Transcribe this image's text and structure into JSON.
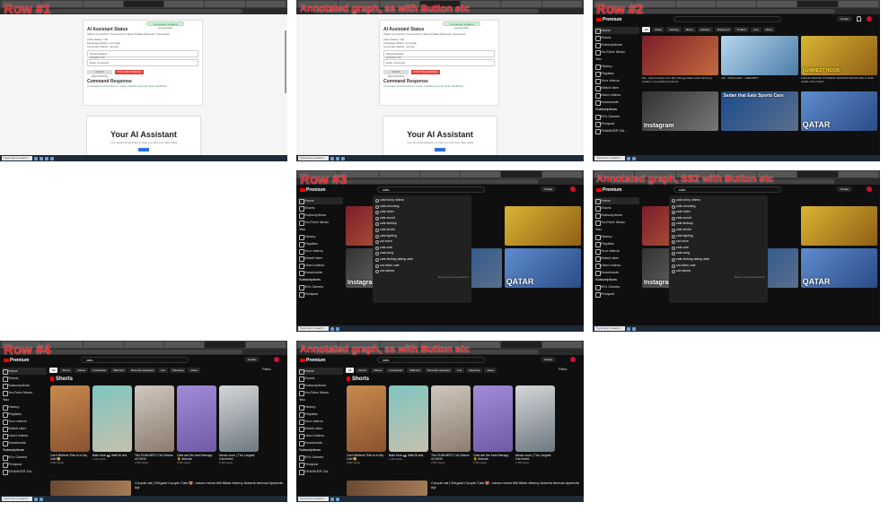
{
  "labels": {
    "b1": "Row #1",
    "b2": "Annotated graph, ss with Button etc",
    "b3": "Row #2",
    "b4": "Row #3",
    "b5": "Annotated graph, SS2 with Button etc",
    "b6": "Row #4",
    "b7": "Annotated graph, ss with Button etc"
  },
  "taskbar": {
    "search": "Type here to search"
  },
  "assistant": {
    "status_title": "AI Assistant Status",
    "status_pill": "Connected, updated successfully",
    "status_lines": [
      "Status Connection: Connected | Latest Update Received: Connected",
      "Voice Status: Idle",
      "Language Status: not ready",
      "Command Status: running"
    ],
    "target_label": "Target website",
    "target_value": "youtube.com",
    "command_placeholder": "Enter command",
    "start_btn": "START RECORDING",
    "stop_btn": "STOP RECORDING",
    "response_title": "Command Response",
    "response_text": "Command sent function in native: website opening when published",
    "hero_title": "Your AI Assistant",
    "hero_sub": "Your personal assistant to help you with your daily tasks"
  },
  "yt": {
    "logo": "Premium",
    "search_value": "cats",
    "create": "Create",
    "sidebar": [
      "Home",
      "Shorts",
      "Subscriptions",
      "YouTube Music"
    ],
    "you_header": "You",
    "you_items": [
      "History",
      "Playlists",
      "Your videos",
      "Watch later",
      "Liked videos",
      "Downloads"
    ],
    "subs_header": "Subscriptions",
    "subs": [
      "90's Games",
      "Firstpost",
      "SHANKER GA..."
    ],
    "chips_home": [
      "All",
      "Music",
      "Gaming",
      "Mixes",
      "Jukebox",
      "Bollywood",
      "Thrillers",
      "Live",
      "News"
    ],
    "chips_search": [
      "All",
      "Shorts",
      "Videos",
      "Unwatched",
      "Watched",
      "Recently uploaded",
      "Live",
      "Meowing",
      "Jokes"
    ],
    "filters": "Filters",
    "videos": [
      {
        "cap": "",
        "title": "Mix - Dharmi Dharmi Ke Mel (Telugu) Male Asha Full Song (Audio) | AsooraSha Pooshedi...",
        "meta": "Updated today"
      },
      {
        "cap": "",
        "title": "Mix - INDO-LEGT - HEMOBOY",
        "meta": "Updated today"
      },
      {
        "cap": "FUNNIEST NOOB",
        "title": "DHOHN DEGHIE FUNNIEST RANDOM NOOB GIRL & GOD LEVEL TAH FIGHT...",
        "meta": "299 views · 3 days ago"
      },
      {
        "cap": "Instagram",
        "title": "",
        "meta": ""
      },
      {
        "cap": "Sedan that Eats Sports Cars",
        "title": "",
        "meta": ""
      },
      {
        "cap": "QATAR",
        "title": "",
        "meta": ""
      }
    ],
    "suggestions": [
      "cats funny videos",
      "cats meowing",
      "cats video",
      "cats sound",
      "cats dinktop",
      "cats shorts",
      "cats fighting",
      "cat voice",
      "cats cute",
      "cats song",
      "cats dinking dating date",
      "cat video cute",
      "cat names"
    ],
    "report": "Report search predictions",
    "shorts_header": "Shorts",
    "shorts": [
      {
        "title": "Can't Believe This is In My Cat! 😂",
        "views": "3.9M views"
      },
      {
        "title": "Bath time 🛁 Wait fit ahs",
        "views": "1.1M views"
      },
      {
        "title": "The FUNNIEST Cat Videos of 2024!",
        "views": "2.5M views"
      },
      {
        "title": "Cats are the best therapy 🐈 #shorts",
        "views": "5.4M views"
      },
      {
        "title": "Meow coon | The Largest Cat breed",
        "views": "2.1M views"
      }
    ],
    "bottom_title": "Couple cat | Elegant Couple Cats 😻, meow meow billi tiktok #funny #shorts #meow #yshorts #yt"
  },
  "colors": {
    "label": "#e4252b",
    "yt_red": "#ff0000",
    "dark_bg": "#0f0f0f"
  }
}
